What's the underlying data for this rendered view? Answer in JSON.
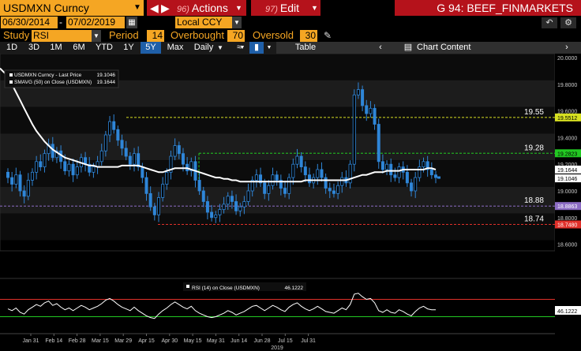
{
  "toolbar": {
    "ticker": "USDMXN Curncy",
    "actions_num": "96)",
    "actions": "Actions",
    "edit_num": "97)",
    "edit": "Edit",
    "title": "G 94: BEEF_FINMARKETS",
    "date_start": "06/30/2014",
    "date_end": "07/02/2019",
    "ccy": "Local CCY",
    "study_label": "Study",
    "study_value": "RSI",
    "period_label": "Period",
    "period_value": "14",
    "overbought_label": "Overbought",
    "overbought_value": "70",
    "oversold_label": "Oversold",
    "oversold_value": "30",
    "ranges": [
      "1D",
      "3D",
      "1M",
      "6M",
      "YTD",
      "1Y",
      "5Y",
      "Max"
    ],
    "selected_range": "5Y",
    "frequency": "Daily",
    "table": "Table",
    "chart_content": "Chart Content"
  },
  "colors": {
    "orange": "#f5a623",
    "red_bar": "#b5121b",
    "candle": "#2f86d8",
    "sma": "#ffffff",
    "yellow_line": "#d7e021",
    "green_line": "#22c922",
    "purple_line": "#8c6cc4",
    "red_line": "#e0302a"
  },
  "chart_data": {
    "type": "candlestick",
    "legend": [
      {
        "name": "USDMXN Curncy - Last Price",
        "value": "19.1046"
      },
      {
        "name": "SMAVG (50)  on Close (USDMXN)",
        "value": "19.1644"
      }
    ],
    "ylim": [
      18.55,
      20.03
    ],
    "yticks": [
      "20.0000",
      "19.8000",
      "19.6000",
      "19.4000",
      "19.2000",
      "19.0000",
      "18.8000",
      "18.6000"
    ],
    "xticks": [
      "Jan 31",
      "Feb 14",
      "Feb 28",
      "Mar 15",
      "Mar 29",
      "Apr 15",
      "Apr 30",
      "May 15",
      "May 31",
      "Jun 14",
      "Jun 28",
      "Jul 15",
      "Jul 31"
    ],
    "year_label": "2019",
    "levels": [
      {
        "label": "19.55",
        "value": 19.5512,
        "tag": "19.5512",
        "color": "#d7e021"
      },
      {
        "label": "19.28",
        "value": 19.2823,
        "tag": "19.2823",
        "color": "#22c922"
      },
      {
        "label": "18.88",
        "value": 18.8863,
        "tag": "18.8863",
        "color": "#8c6cc4"
      },
      {
        "label": "18.74",
        "value": 18.748,
        "tag": "18.7480",
        "color": "#e0302a"
      }
    ],
    "last_price_tag": "19.1046",
    "sma_tag": "19.1644",
    "close": [
      19.1,
      19.05,
      19.12,
      19.0,
      18.96,
      19.08,
      19.14,
      19.22,
      19.18,
      19.28,
      19.35,
      19.25,
      19.3,
      19.22,
      19.15,
      19.2,
      19.12,
      19.18,
      19.25,
      19.2,
      19.14,
      19.18,
      19.22,
      19.3,
      19.42,
      19.52,
      19.46,
      19.38,
      19.32,
      19.26,
      19.2,
      19.28,
      19.18,
      19.1,
      18.98,
      18.88,
      18.82,
      18.95,
      19.05,
      19.14,
      19.26,
      19.34,
      19.28,
      19.2,
      19.15,
      19.22,
      19.08,
      19.0,
      18.92,
      18.84,
      18.8,
      18.82,
      18.86,
      18.9,
      18.96,
      18.92,
      18.85,
      18.88,
      18.92,
      19.0,
      19.08,
      19.12,
      19.06,
      18.98,
      19.04,
      19.12,
      19.08,
      19.02,
      18.98,
      19.1,
      19.2,
      19.26,
      19.18,
      19.12,
      19.06,
      19.1,
      19.16,
      19.1,
      19.02,
      19.0,
      18.98,
      19.04,
      19.1,
      19.06,
      19.2,
      19.72,
      19.76,
      19.64,
      19.58,
      19.62,
      19.5,
      19.22,
      19.16,
      19.2,
      19.12,
      19.1,
      19.18,
      19.14,
      19.06,
      19.0,
      19.1,
      19.18,
      19.22,
      19.16,
      19.12,
      19.1
    ],
    "sma": [
      19.86,
      19.8,
      19.74,
      19.68,
      19.62,
      19.56,
      19.5,
      19.45,
      19.41,
      19.37,
      19.34,
      19.31,
      19.29,
      19.27,
      19.25,
      19.24,
      19.23,
      19.22,
      19.21,
      19.2,
      19.19,
      19.19,
      19.18,
      19.18,
      19.18,
      19.18,
      19.18,
      19.18,
      19.19,
      19.19,
      19.19,
      19.19,
      19.19,
      19.18,
      19.17,
      19.16,
      19.15,
      19.14,
      19.14,
      19.15,
      19.16,
      19.17,
      19.17,
      19.17,
      19.17,
      19.16,
      19.15,
      19.14,
      19.13,
      19.12,
      19.11,
      19.1,
      19.1,
      19.09,
      19.09,
      19.08,
      19.08,
      19.07,
      19.07,
      19.07,
      19.07,
      19.07,
      19.07,
      19.07,
      19.07,
      19.07,
      19.07,
      19.07,
      19.07,
      19.07,
      19.07,
      19.07,
      19.07,
      19.08,
      19.08,
      19.08,
      19.08,
      19.08,
      19.08,
      19.08,
      19.08,
      19.08,
      19.08,
      19.08,
      19.09,
      19.1,
      19.11,
      19.12,
      19.12,
      19.13,
      19.14,
      19.14,
      19.14,
      19.15,
      19.15,
      19.15,
      19.15,
      19.16,
      19.16,
      19.16,
      19.16,
      19.16,
      19.16,
      19.17,
      19.17,
      19.16
    ],
    "rsi": {
      "legend": "RSI (14)  on Close (USDMXN)",
      "legend_value": "46.1222",
      "tag": "46.1222",
      "overbought": 70,
      "oversold": 30,
      "values": [
        48,
        44,
        50,
        40,
        36,
        46,
        52,
        58,
        54,
        62,
        66,
        56,
        60,
        52,
        46,
        50,
        44,
        50,
        56,
        52,
        46,
        50,
        54,
        60,
        68,
        72,
        66,
        58,
        52,
        48,
        44,
        52,
        44,
        38,
        32,
        28,
        26,
        36,
        44,
        50,
        58,
        64,
        58,
        52,
        48,
        54,
        44,
        38,
        34,
        30,
        28,
        30,
        34,
        38,
        44,
        40,
        34,
        38,
        42,
        48,
        54,
        56,
        50,
        44,
        50,
        56,
        52,
        46,
        42,
        52,
        58,
        62,
        54,
        48,
        44,
        48,
        54,
        48,
        42,
        40,
        38,
        44,
        50,
        46,
        58,
        82,
        84,
        76,
        70,
        72,
        62,
        44,
        40,
        46,
        40,
        38,
        46,
        42,
        36,
        32,
        42,
        50,
        54,
        48,
        46,
        46
      ]
    }
  }
}
